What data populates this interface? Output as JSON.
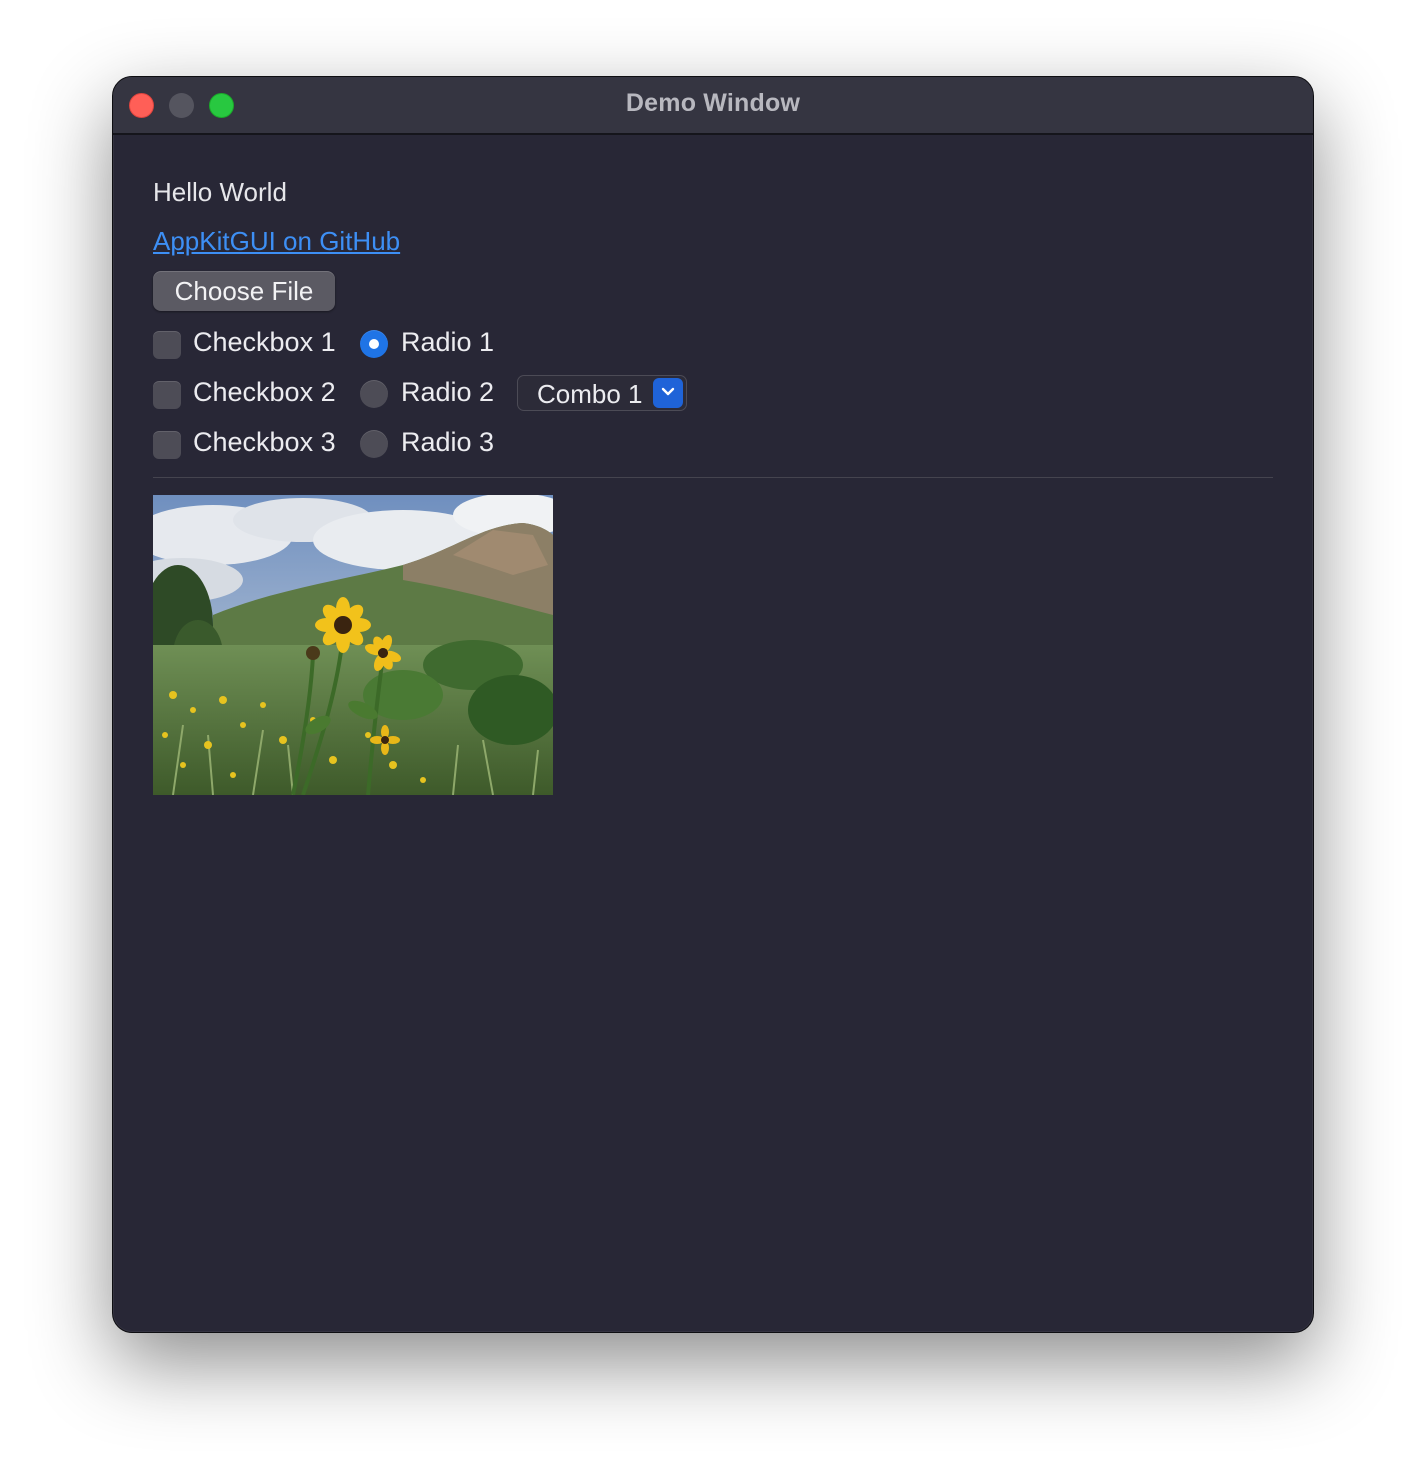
{
  "window": {
    "title": "Demo Window"
  },
  "content": {
    "hello_text": "Hello World",
    "link_text": "AppKitGUI on GitHub",
    "choose_file_label": "Choose File",
    "checkboxes": [
      {
        "label": "Checkbox 1",
        "checked": false
      },
      {
        "label": "Checkbox 2",
        "checked": false
      },
      {
        "label": "Checkbox 3",
        "checked": false
      }
    ],
    "radios": [
      {
        "label": "Radio 1",
        "selected": true
      },
      {
        "label": "Radio 2",
        "selected": false
      },
      {
        "label": "Radio 3",
        "selected": false
      }
    ],
    "combo": {
      "value": "Combo 1"
    },
    "image": {
      "subject": "sunflower meadow with rocky hillside"
    }
  },
  "colors": {
    "window_bg": "#282736",
    "titlebar_bg": "#353541",
    "link": "#3d8ff5",
    "accent": "#1f74e6",
    "close": "#ff5f57",
    "zoom": "#28c840"
  }
}
